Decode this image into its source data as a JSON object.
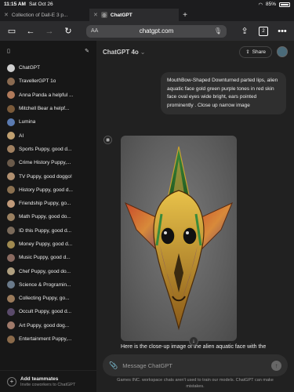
{
  "status": {
    "time": "11:15 AM",
    "date": "Sat Oct 26",
    "battery": "85%"
  },
  "tabs": [
    {
      "label": "Collection of Dall-E 3 p...",
      "close": "✕"
    },
    {
      "label": "ChatGPT",
      "close": "✕"
    }
  ],
  "toolbar": {
    "url": "chatgpt.com",
    "tab_count": "2",
    "text_size": "AA"
  },
  "sidebar": {
    "items": [
      {
        "label": "ChatGPT",
        "color": "#cfcfcf"
      },
      {
        "label": "TravellerGPT 1o",
        "color": "#8a6a50"
      },
      {
        "label": "Anna Panda a helpful ...",
        "color": "#b07a5a"
      },
      {
        "label": "Mitchell Bear a helpf...",
        "color": "#7a5a3a"
      },
      {
        "label": "Lumina",
        "color": "#5a7ab0"
      },
      {
        "label": "AI",
        "color": "#c0a070"
      },
      {
        "label": "Sports Puppy, good d...",
        "color": "#a08060"
      },
      {
        "label": "Crime History Puppy,...",
        "color": "#6a5a4a"
      },
      {
        "label": "TV Puppy, good doggo!",
        "color": "#b09070"
      },
      {
        "label": "History Puppy, good d...",
        "color": "#8a7050"
      },
      {
        "label": "Friendship Puppy, go...",
        "color": "#c09a7a"
      },
      {
        "label": "Math Puppy, good do...",
        "color": "#9a8060"
      },
      {
        "label": "ID this Puppy, good d...",
        "color": "#7a6a5a"
      },
      {
        "label": "Money Puppy, good d...",
        "color": "#a08a50"
      },
      {
        "label": "Music Puppy, good d...",
        "color": "#8a6a60"
      },
      {
        "label": "Chef Puppy, good do...",
        "color": "#b0a080"
      },
      {
        "label": "Science & Programin...",
        "color": "#6a7a8a"
      },
      {
        "label": "Collecting Puppy, go...",
        "color": "#9a7a5a"
      },
      {
        "label": "Occult Puppy, good d...",
        "color": "#5a4a6a"
      },
      {
        "label": "Art Puppy, good dog...",
        "color": "#a07a6a"
      },
      {
        "label": "Entertainment Puppy,...",
        "color": "#8a6a4a"
      }
    ],
    "add_teammates": "Add teammates",
    "invite_text": "Invite coworkers to ChatGPT"
  },
  "main": {
    "model": "ChatGPT 4o",
    "share_label": "Share",
    "user_message": "MouthBow-Shaped Downturned parted lips, alien  aquatic face gold green purple tones in red skin face oval eyes wide bright,  ears pointed prominently . Close up narrow image",
    "reply_text": "Here is the close-up image of the alien aquatic face with the",
    "composer_placeholder": "Message ChatGPT",
    "disclaimer": "Games INC. workspace chats aren't used to train our models. ChatGPT can make mistakes."
  }
}
